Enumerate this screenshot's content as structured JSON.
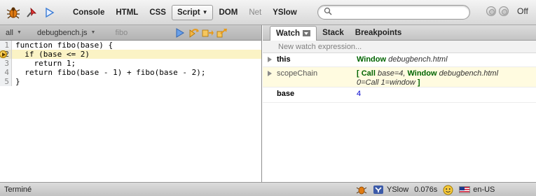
{
  "toolbar": {
    "tabs": [
      {
        "label": "Console"
      },
      {
        "label": "HTML"
      },
      {
        "label": "CSS"
      },
      {
        "label": "Script"
      },
      {
        "label": "DOM"
      },
      {
        "label": "Net"
      },
      {
        "label": "YSlow"
      }
    ],
    "selected_tab": "Script",
    "search": {
      "value": "",
      "placeholder": ""
    },
    "off_label": "Off"
  },
  "left_bar": {
    "scope": "all",
    "file": "debugbench.js",
    "stack_function": "fibo"
  },
  "code": {
    "lines": [
      {
        "number": "1",
        "text": "function fibo(base) {"
      },
      {
        "number": "2",
        "text": "  if (base <= 2)"
      },
      {
        "number": "3",
        "text": "    return 1;"
      },
      {
        "number": "4",
        "text": "  return fibo(base - 1) + fibo(base - 2);"
      },
      {
        "number": "5",
        "text": "}"
      }
    ],
    "current_line": 2
  },
  "right_tabs": {
    "watch": "Watch",
    "stack": "Stack",
    "breakpoints": "Breakpoints"
  },
  "watch": {
    "new_expression": "New watch expression...",
    "this": {
      "name": "this",
      "value_bold": "Window",
      "value_italic": "debugbench.html"
    },
    "scope_chain": {
      "name": "scopeChain",
      "open_bracket": "[",
      "call": "Call",
      "call_arg": "base=4,",
      "window": "Window",
      "window_file": "debugbench.html",
      "line2_index0": "0=",
      "line2_call": "Call",
      "line2_index1": "1=",
      "line2_window": "window",
      "close_bracket": "]"
    },
    "base": {
      "name": "base",
      "value": "4"
    }
  },
  "status": {
    "text": "Terminé",
    "yslow": "YSlow",
    "time": "0.076s",
    "locale": "en-US"
  },
  "colors": {
    "current_line_bg": "#fbf3c5",
    "watch_value_green": "#006400",
    "watch_value_blue": "#0000cc"
  }
}
